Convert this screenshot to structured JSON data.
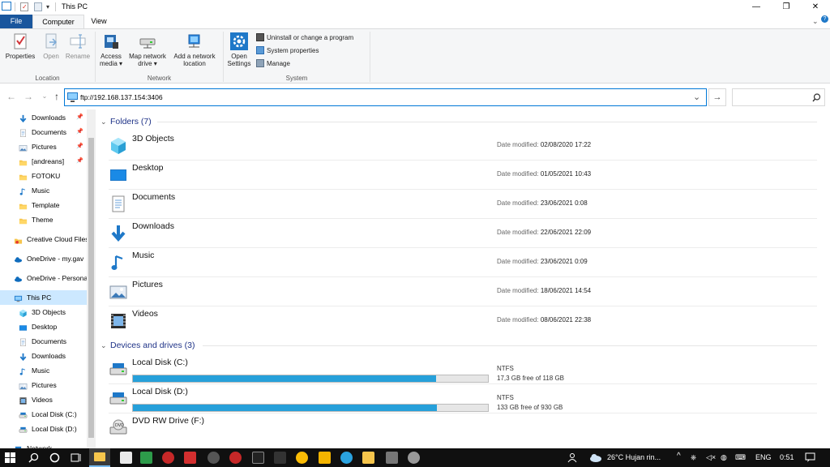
{
  "window": {
    "title": "This PC",
    "minimize": "—",
    "restore": "❐",
    "close": "✕"
  },
  "ribbon": {
    "tabs": {
      "file": "File",
      "computer": "Computer",
      "view": "View"
    },
    "location": {
      "label": "Location",
      "properties": "Properties",
      "open": "Open",
      "rename": "Rename"
    },
    "network": {
      "label": "Network",
      "access_media_1": "Access",
      "access_media_2": "media ▾",
      "map_drive_1": "Map network",
      "map_drive_2": "drive ▾",
      "add_location_1": "Add a network",
      "add_location_2": "location"
    },
    "system": {
      "label": "System",
      "open_settings_1": "Open",
      "open_settings_2": "Settings",
      "uninstall": "Uninstall or change a program",
      "system_properties": "System properties",
      "manage": "Manage"
    }
  },
  "address": {
    "path": "ftp://192.168.137.154:3406",
    "dropdown": "⌄",
    "go": "→"
  },
  "nav": {
    "items": [
      {
        "label": "Downloads",
        "icon": "download-arrow",
        "pinned": true
      },
      {
        "label": "Documents",
        "icon": "document",
        "pinned": true
      },
      {
        "label": "Pictures",
        "icon": "pictures",
        "pinned": true
      },
      {
        "label": "[andreans]",
        "icon": "folder",
        "pinned": true
      },
      {
        "label": "FOTOKU",
        "icon": "folder",
        "pinned": false
      },
      {
        "label": "Music",
        "icon": "music",
        "pinned": false
      },
      {
        "label": "Template",
        "icon": "folder",
        "pinned": false
      },
      {
        "label": "Theme",
        "icon": "folder",
        "pinned": false
      },
      {
        "label": "Creative Cloud Files",
        "icon": "creative-cloud",
        "pinned": false
      },
      {
        "label": "OneDrive - my.gav",
        "icon": "onedrive",
        "pinned": false
      },
      {
        "label": "OneDrive - Personal",
        "icon": "onedrive",
        "pinned": false
      },
      {
        "label": "This PC",
        "icon": "this-pc",
        "pinned": false
      },
      {
        "label": "3D Objects",
        "icon": "3d-objects",
        "pinned": false
      },
      {
        "label": "Desktop",
        "icon": "desktop",
        "pinned": false
      },
      {
        "label": "Documents",
        "icon": "document",
        "pinned": false
      },
      {
        "label": "Downloads",
        "icon": "download-arrow",
        "pinned": false
      },
      {
        "label": "Music",
        "icon": "music",
        "pinned": false
      },
      {
        "label": "Pictures",
        "icon": "pictures",
        "pinned": false
      },
      {
        "label": "Videos",
        "icon": "videos",
        "pinned": false
      },
      {
        "label": "Local Disk (C:)",
        "icon": "drive",
        "pinned": false
      },
      {
        "label": "Local Disk (D:)",
        "icon": "drive",
        "pinned": false
      },
      {
        "label": "Network",
        "icon": "network",
        "pinned": false
      }
    ]
  },
  "content": {
    "folders_header": "Folders (7)",
    "date_label": "Date modified: ",
    "folders": [
      {
        "name": "3D Objects",
        "date": "02/08/2020 17:22",
        "icon": "3d-objects"
      },
      {
        "name": "Desktop",
        "date": "01/05/2021 10:43",
        "icon": "desktop"
      },
      {
        "name": "Documents",
        "date": "23/06/2021 0:08",
        "icon": "document"
      },
      {
        "name": "Downloads",
        "date": "22/06/2021 22:09",
        "icon": "download-arrow"
      },
      {
        "name": "Music",
        "date": "23/06/2021 0:09",
        "icon": "music"
      },
      {
        "name": "Pictures",
        "date": "18/06/2021 14:54",
        "icon": "pictures"
      },
      {
        "name": "Videos",
        "date": "08/06/2021 22:38",
        "icon": "videos"
      }
    ],
    "devices_header": "Devices and drives (3)",
    "drives": [
      {
        "name": "Local Disk (C:)",
        "fs": "NTFS",
        "free": "17,3 GB free of 118 GB",
        "used_fraction": 0.853
      },
      {
        "name": "Local Disk (D:)",
        "fs": "NTFS",
        "free": "133 GB free of 930 GB",
        "used_fraction": 0.857
      },
      {
        "name": "DVD RW Drive (F:)",
        "fs": "",
        "free": "",
        "used_fraction": null
      }
    ]
  },
  "taskbar": {
    "weather": "26°C  Hujan rin...",
    "lang": "ENG",
    "time": "0:51"
  },
  "colors": {
    "accent": "#0078d7",
    "file_tab": "#19569d",
    "drive_fill": "#26a0da",
    "selection": "#cce8ff"
  }
}
